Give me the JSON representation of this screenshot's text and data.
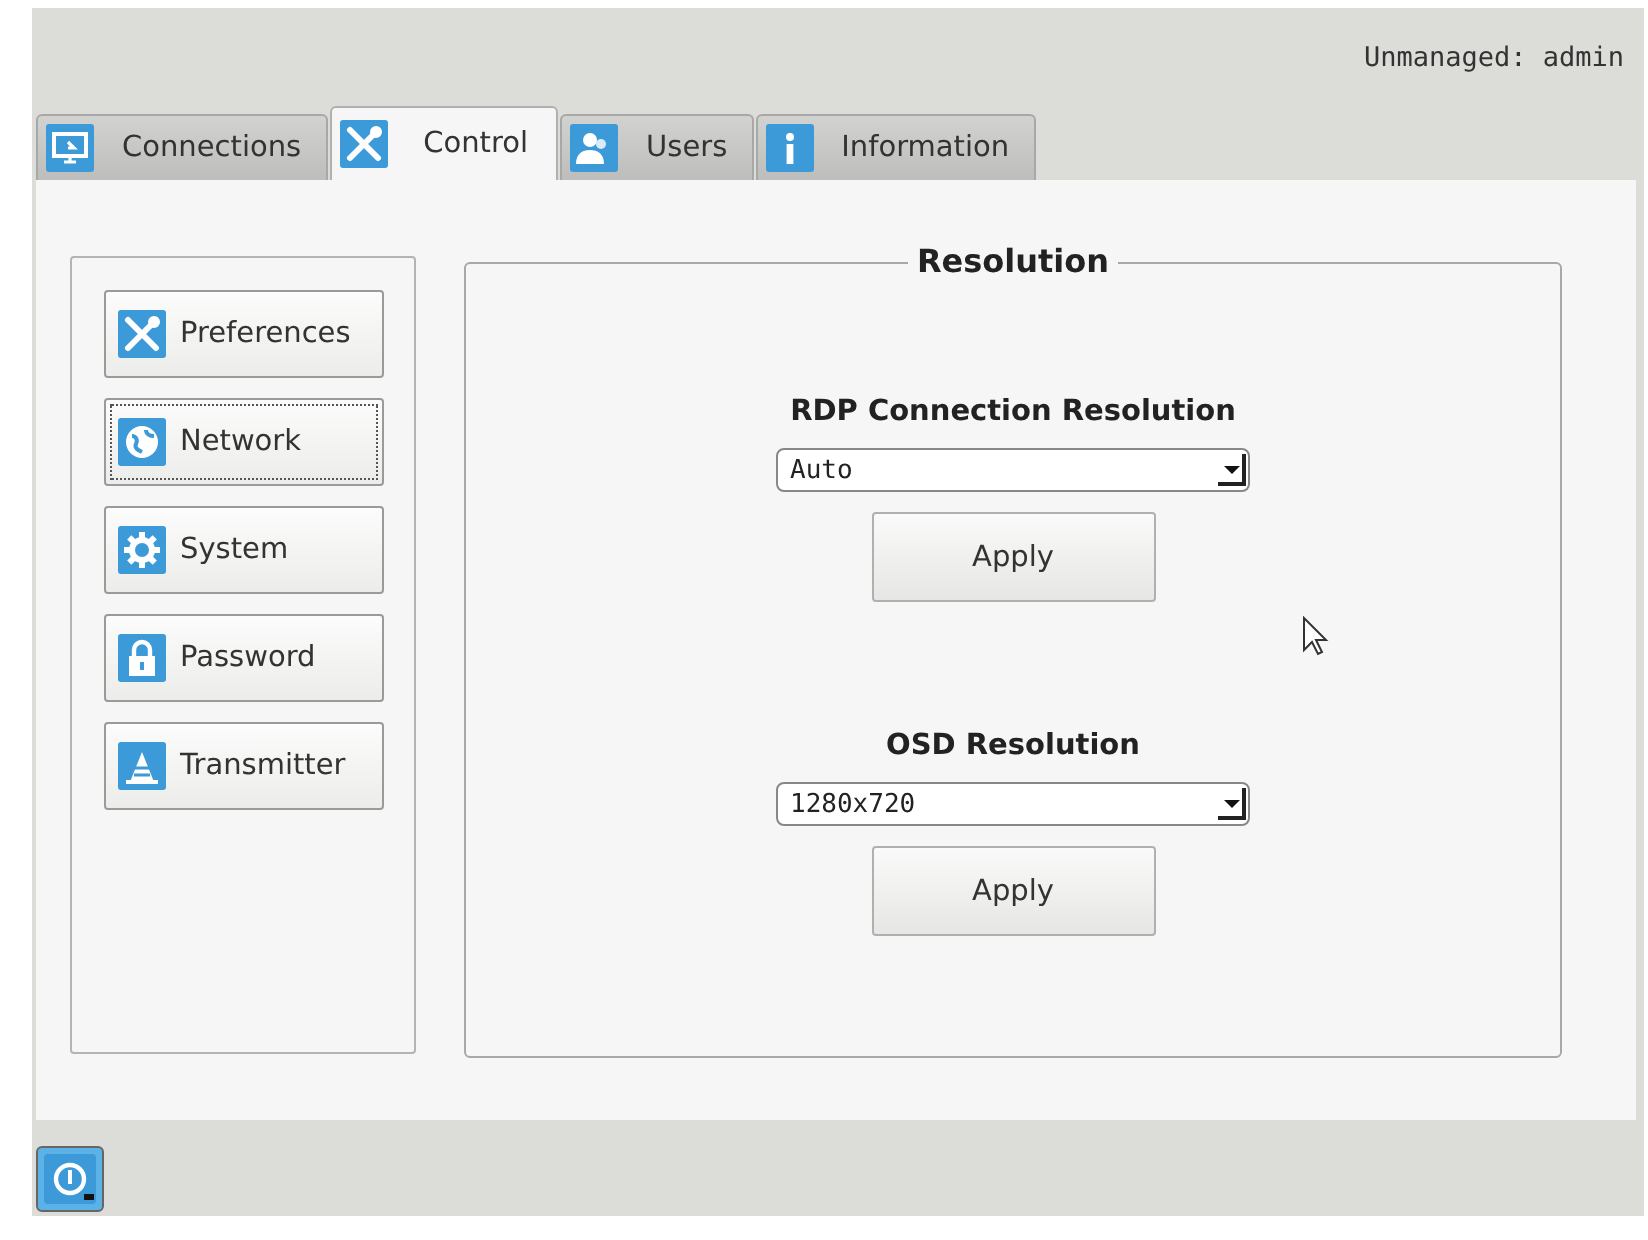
{
  "header": {
    "user_status": "Unmanaged: admin"
  },
  "tabs": [
    {
      "label": "Connections",
      "kind": "monitor",
      "selected": false
    },
    {
      "label": "Control",
      "kind": "tools",
      "selected": true
    },
    {
      "label": "Users",
      "kind": "users",
      "selected": false
    },
    {
      "label": "Information",
      "kind": "info",
      "selected": false
    }
  ],
  "sidebar": {
    "items": [
      {
        "label": "Preferences",
        "kind": "tools",
        "focused": false
      },
      {
        "label": "Network",
        "kind": "globe",
        "focused": true
      },
      {
        "label": "System",
        "kind": "gear",
        "focused": false
      },
      {
        "label": "Password",
        "kind": "lock",
        "focused": false
      },
      {
        "label": "Transmitter",
        "kind": "beacon",
        "focused": false
      }
    ]
  },
  "panel": {
    "title": "Resolution",
    "settings": [
      {
        "label": "RDP Connection Resolution",
        "value": "Auto",
        "button": "Apply"
      },
      {
        "label": "OSD Resolution",
        "value": "1280x720",
        "button": "Apply"
      }
    ]
  }
}
